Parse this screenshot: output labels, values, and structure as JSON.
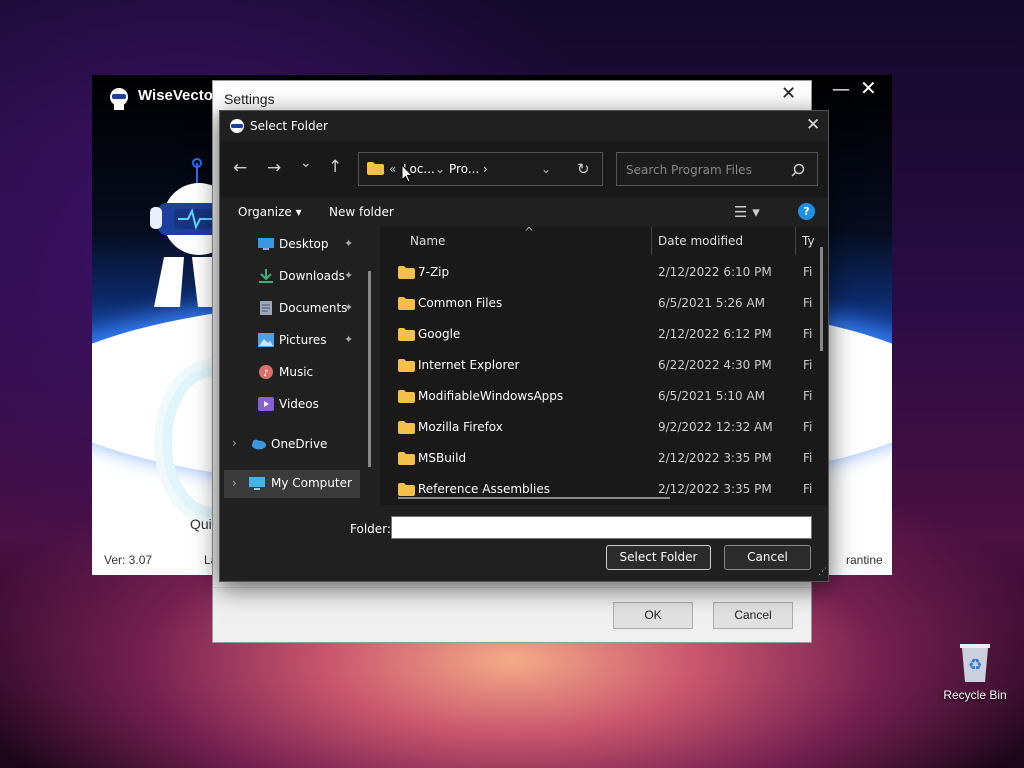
{
  "wisevector": {
    "title": "WiseVector",
    "quick_label": "Qui",
    "version": "Ver: 3.07",
    "left_fragment": "La",
    "quarantine_fragment": "rantine",
    "minimize_glyph": "—",
    "close_glyph": "✕",
    "gear_glyph": "⁚"
  },
  "settings": {
    "title": "Settings",
    "close_glyph": "✕",
    "ok_label": "OK",
    "cancel_label": "Cancel"
  },
  "select_folder": {
    "title": "Select Folder",
    "close_glyph": "✕",
    "nav": {
      "back": "←",
      "forward": "→",
      "recent": "⌄",
      "up": "↑"
    },
    "address": {
      "overflow": "«",
      "crumbs": [
        "Loc...",
        "Pro..."
      ],
      "separator": "›",
      "dropdown": "⌄",
      "refresh": "↻"
    },
    "search_placeholder": "Search Program Files",
    "organize_label": "Organize ▾",
    "new_folder_label": "New folder",
    "view_glyph": "☰ ▾",
    "help_glyph": "?",
    "nav_pane": [
      {
        "label": "Desktop",
        "pinned": true,
        "icon": "desktop-icon",
        "color": "#3a96dd"
      },
      {
        "label": "Downloads",
        "pinned": true,
        "icon": "download-icon",
        "color": "#3bb273"
      },
      {
        "label": "Documents",
        "pinned": true,
        "icon": "document-icon",
        "color": "#9aa8b8"
      },
      {
        "label": "Pictures",
        "pinned": true,
        "icon": "picture-icon",
        "color": "#4aa3e8"
      },
      {
        "label": "Music",
        "pinned": false,
        "icon": "music-icon",
        "color": "#d9706a"
      },
      {
        "label": "Videos",
        "pinned": false,
        "icon": "video-icon",
        "color": "#8a5fd6"
      },
      {
        "label": "OneDrive",
        "pinned": false,
        "icon": "cloud-icon",
        "color": "#3a96dd"
      },
      {
        "label": "My Computer",
        "pinned": false,
        "icon": "computer-icon",
        "color": "#43b3e8"
      }
    ],
    "pin_glyph": "📌",
    "chevron_glyph": "›",
    "columns": {
      "name": "Name",
      "date": "Date modified",
      "type": "Ty"
    },
    "sort_glyph": "^",
    "files": [
      {
        "name": "7-Zip",
        "date": "2/12/2022 6:10 PM",
        "type": "Fi"
      },
      {
        "name": "Common Files",
        "date": "6/5/2021 5:26 AM",
        "type": "Fi"
      },
      {
        "name": "Google",
        "date": "2/12/2022 6:12 PM",
        "type": "Fi"
      },
      {
        "name": "Internet Explorer",
        "date": "6/22/2022 4:30 PM",
        "type": "Fi"
      },
      {
        "name": "ModifiableWindowsApps",
        "date": "6/5/2021 5:10 AM",
        "type": "Fi"
      },
      {
        "name": "Mozilla Firefox",
        "date": "9/2/2022 12:32 AM",
        "type": "Fi"
      },
      {
        "name": "MSBuild",
        "date": "2/12/2022 3:35 PM",
        "type": "Fi"
      },
      {
        "name": "Reference Assemblies",
        "date": "2/12/2022 3:35 PM",
        "type": "Fi"
      }
    ],
    "folder_label": "Folder:",
    "folder_value": "",
    "select_button": "Select Folder",
    "cancel_button": "Cancel",
    "grip_glyph": "⋰"
  },
  "desktop": {
    "recycle_bin_label": "Recycle Bin"
  },
  "colors": {
    "dialog_bg": "#202020",
    "accent": "#1d8fe5",
    "folder": "#f3c04a"
  }
}
